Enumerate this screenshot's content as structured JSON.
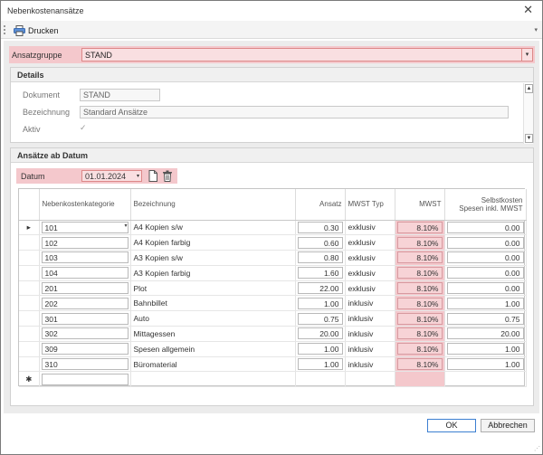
{
  "window": {
    "title": "Nebenkostenansätze"
  },
  "toolbar": {
    "print_label": "Drucken"
  },
  "ansatzgruppe": {
    "label": "Ansatzgruppe",
    "value": "STAND"
  },
  "details": {
    "header": "Details",
    "dokument_label": "Dokument",
    "dokument_value": "STAND",
    "bezeichnung_label": "Bezeichnung",
    "bezeichnung_value": "Standard Ansätze",
    "aktiv_label": "Aktiv"
  },
  "rates": {
    "header": "Ansätze ab Datum",
    "datum_label": "Datum",
    "datum_value": "01.01.2024"
  },
  "grid": {
    "columns": {
      "kategorie": "Nebenkostenkategorie",
      "bezeichnung": "Bezeichnung",
      "ansatz": "Ansatz",
      "mwst_typ": "MWST Typ",
      "mwst": "MWST",
      "selbstkosten_1": "Selbstkosten",
      "selbstkosten_2": "Spesen inkl. MWST"
    },
    "rows": [
      {
        "kategorie": "101",
        "bezeichnung": "A4 Kopien s/w",
        "ansatz": "0.30",
        "mwst_typ": "exklusiv",
        "mwst": "8.10%",
        "selbstkosten": "0.00"
      },
      {
        "kategorie": "102",
        "bezeichnung": "A4 Kopien farbig",
        "ansatz": "0.60",
        "mwst_typ": "exklusiv",
        "mwst": "8.10%",
        "selbstkosten": "0.00"
      },
      {
        "kategorie": "103",
        "bezeichnung": "A3 Kopien s/w",
        "ansatz": "0.80",
        "mwst_typ": "exklusiv",
        "mwst": "8.10%",
        "selbstkosten": "0.00"
      },
      {
        "kategorie": "104",
        "bezeichnung": "A3 Kopien farbig",
        "ansatz": "1.60",
        "mwst_typ": "exklusiv",
        "mwst": "8.10%",
        "selbstkosten": "0.00"
      },
      {
        "kategorie": "201",
        "bezeichnung": "Plot",
        "ansatz": "22.00",
        "mwst_typ": "exklusiv",
        "mwst": "8.10%",
        "selbstkosten": "0.00"
      },
      {
        "kategorie": "202",
        "bezeichnung": "Bahnbillet",
        "ansatz": "1.00",
        "mwst_typ": "inklusiv",
        "mwst": "8.10%",
        "selbstkosten": "1.00"
      },
      {
        "kategorie": "301",
        "bezeichnung": "Auto",
        "ansatz": "0.75",
        "mwst_typ": "inklusiv",
        "mwst": "8.10%",
        "selbstkosten": "0.75"
      },
      {
        "kategorie": "302",
        "bezeichnung": "Mittagessen",
        "ansatz": "20.00",
        "mwst_typ": "inklusiv",
        "mwst": "8.10%",
        "selbstkosten": "20.00"
      },
      {
        "kategorie": "309",
        "bezeichnung": "Spesen allgemein",
        "ansatz": "1.00",
        "mwst_typ": "inklusiv",
        "mwst": "8.10%",
        "selbstkosten": "1.00"
      },
      {
        "kategorie": "310",
        "bezeichnung": "Büromaterial",
        "ansatz": "1.00",
        "mwst_typ": "inklusiv",
        "mwst": "8.10%",
        "selbstkosten": "1.00"
      }
    ],
    "current_row_icon": "row-pointer-icon",
    "new_row_icon": "new-row-star-icon"
  },
  "buttons": {
    "ok": "OK",
    "cancel": "Abbrechen"
  },
  "colors": {
    "highlight": "#f4c8cc",
    "accent": "#3c7fd1"
  }
}
